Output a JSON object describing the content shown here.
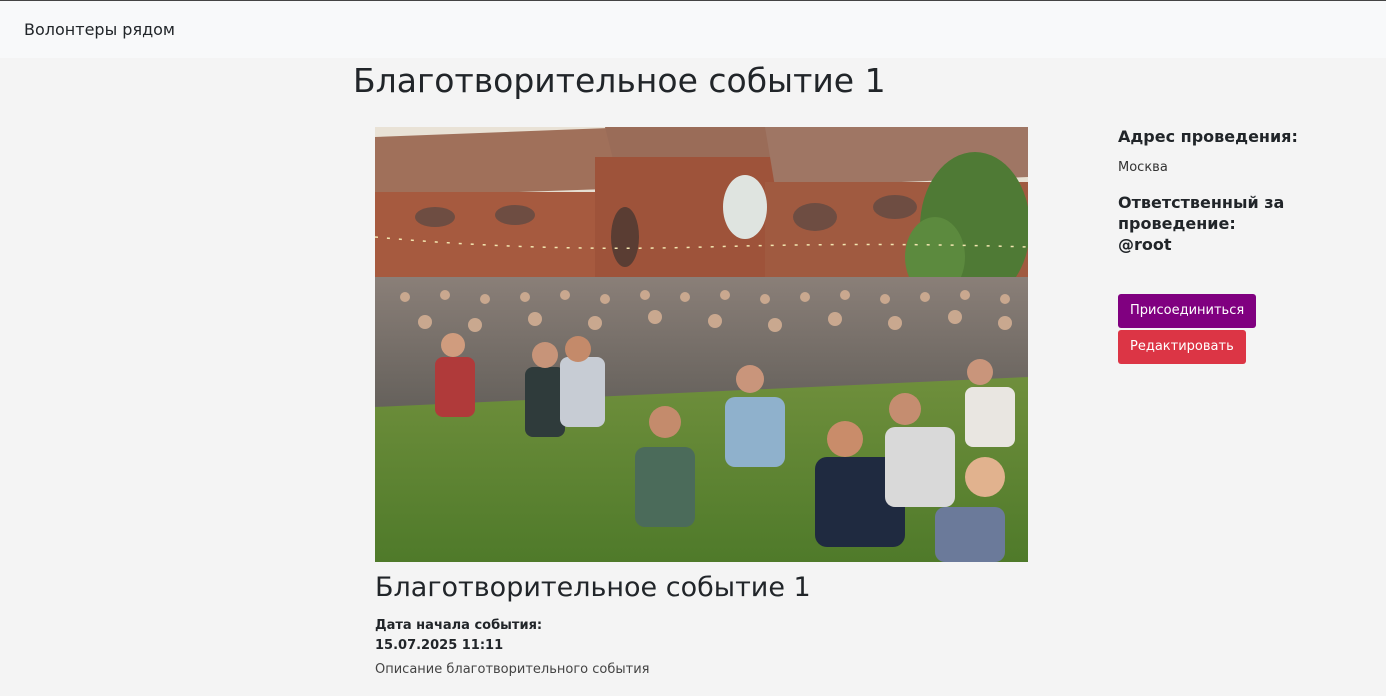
{
  "navbar": {
    "brand": "Волонтеры рядом"
  },
  "page": {
    "title": "Благотворительное событие 1"
  },
  "event": {
    "image_alt": "Фото события",
    "title": "Благотворительное событие 1",
    "date_label": "Дата начала события:",
    "date_value": "15.07.2025 11:11",
    "description": "Описание благотворительного события"
  },
  "sidebar": {
    "address_heading": "Адрес проведения:",
    "address_value": "Москва",
    "responsible_heading": "Ответственный за проведение:",
    "responsible_user": "@root",
    "join_button": "Присоединиться",
    "edit_button": "Редактировать"
  },
  "colors": {
    "join_button": "#800080",
    "edit_button": "#dc3545",
    "navbar_bg": "#f8f9fa",
    "page_bg": "#f4f4f4"
  }
}
